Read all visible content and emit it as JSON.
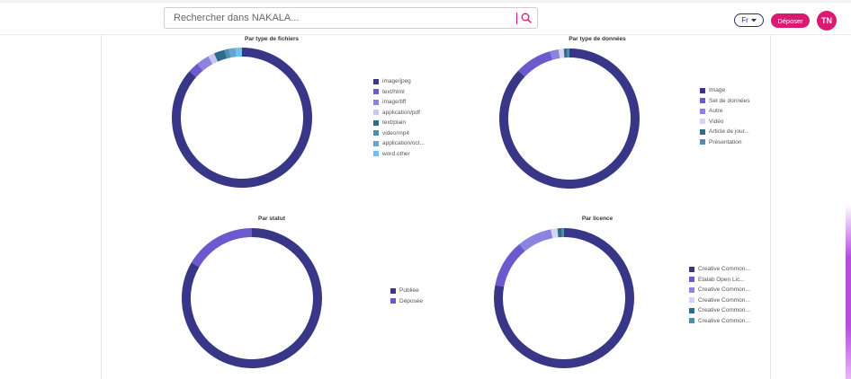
{
  "header": {
    "search_placeholder": "Rechercher dans NAKALA...",
    "language_label": "Fr",
    "deposit_label": "Déposer",
    "avatar_initials": "TN",
    "accent_color": "#d81b72"
  },
  "chart_data": [
    {
      "type": "pie",
      "title": "Par type de fichiers",
      "categories": [
        "image/jpeg",
        "text/html",
        "image/tiff",
        "application/pdf",
        "text/plain",
        "video/mp4",
        "application/oct...",
        "word.other"
      ],
      "values": [
        86.5,
        2.5,
        3.0,
        1.5,
        2.5,
        1.0,
        1.5,
        1.5
      ],
      "colors": [
        "#383787",
        "#6a5acd",
        "#8a84e0",
        "#c8c6f2",
        "#2e6b8a",
        "#4e8fb0",
        "#5fa6d0",
        "#6ec2ef"
      ],
      "legend_position": "right"
    },
    {
      "type": "pie",
      "title": "Par type de données",
      "categories": [
        "Image",
        "Set de données",
        "Autre",
        "Vidéo",
        "Article de jour...",
        "Présentation"
      ],
      "values": [
        87.0,
        8.5,
        2.0,
        1.2,
        0.8,
        0.5
      ],
      "colors": [
        "#383787",
        "#6a5acd",
        "#8a84e0",
        "#d6d4f5",
        "#2e6b8a",
        "#4e8fb0"
      ],
      "legend_position": "right"
    },
    {
      "type": "pie",
      "title": "Par statut",
      "categories": [
        "Publiée",
        "Déposée"
      ],
      "values": [
        83.5,
        16.5
      ],
      "colors": [
        "#383787",
        "#6a5acd"
      ],
      "legend_position": "right"
    },
    {
      "type": "pie",
      "title": "Par licence",
      "categories": [
        "Creative Common...",
        "Etalab Open Lic...",
        "Creative Common...",
        "Creative Common...",
        "Creative Common...",
        "Creative Common..."
      ],
      "values": [
        78.0,
        11.0,
        8.0,
        1.5,
        1.0,
        0.5
      ],
      "colors": [
        "#383787",
        "#6a5acd",
        "#8a84e0",
        "#d6d4f5",
        "#2e6b8a",
        "#4e8fb0"
      ],
      "legend_position": "right"
    }
  ]
}
